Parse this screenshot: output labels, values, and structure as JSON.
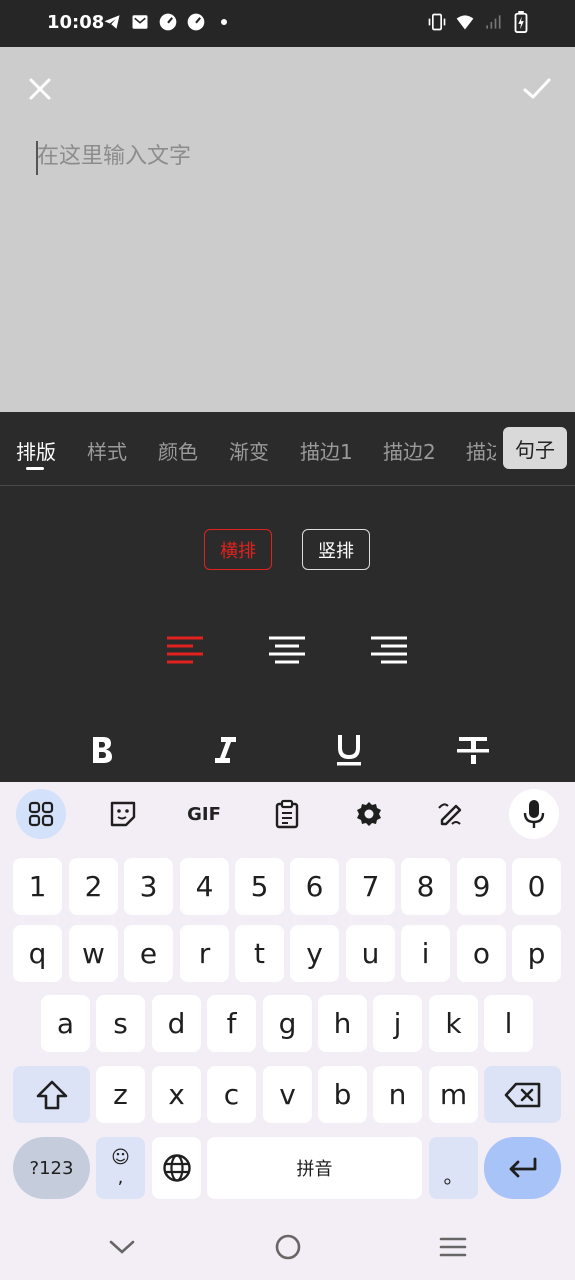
{
  "status_bar": {
    "time": "10:08",
    "left_icons": [
      "telegram-icon",
      "mail-icon",
      "speedometer-icon",
      "speedometer-icon",
      "dot-icon"
    ],
    "right_icons": [
      "vibrate-icon",
      "wifi-icon",
      "signal-icon",
      "battery-charging-icon"
    ]
  },
  "editor": {
    "placeholder": "在这里输入文字",
    "close_icon": "close-icon",
    "confirm_icon": "check-icon"
  },
  "tabs": {
    "items": [
      "排版",
      "样式",
      "颜色",
      "渐变",
      "描边1",
      "描边2"
    ],
    "overflow_partial": "描边",
    "active_index": 0,
    "sentence_button": "句子"
  },
  "orientation": {
    "horizontal": "横排",
    "vertical": "竖排",
    "selected": "horizontal"
  },
  "alignment": {
    "options": [
      "align-left-icon",
      "align-center-icon",
      "align-right-icon"
    ],
    "selected": "align-left-icon"
  },
  "format": {
    "options": [
      "bold-icon",
      "italic-icon",
      "underline-icon",
      "strikethrough-icon"
    ]
  },
  "keyboard": {
    "toolbar": [
      "apps-grid-icon",
      "sticker-icon",
      "GIF",
      "clipboard-icon",
      "settings-icon",
      "handwriting-icon",
      "mic-icon"
    ],
    "row_numbers": [
      "1",
      "2",
      "3",
      "4",
      "5",
      "6",
      "7",
      "8",
      "9",
      "0"
    ],
    "row1": [
      "q",
      "w",
      "e",
      "r",
      "t",
      "y",
      "u",
      "i",
      "o",
      "p"
    ],
    "row2": [
      "a",
      "s",
      "d",
      "f",
      "g",
      "h",
      "j",
      "k",
      "l"
    ],
    "row3": [
      "z",
      "x",
      "c",
      "v",
      "b",
      "n",
      "m"
    ],
    "symbols_key": "?123",
    "emoji_key_top": "☺",
    "emoji_key_bottom": ",",
    "space_label": "拼音",
    "period_key": "。"
  },
  "colors": {
    "accent_red": "#e0221e",
    "panel_bg": "#2b2b2b",
    "editor_bg": "#cccccc",
    "keyboard_bg": "#f3eef6",
    "enter_key": "#a8c3f7"
  },
  "nav_bar": [
    "back-chevron-icon",
    "home-circle-icon",
    "menu-icon"
  ]
}
